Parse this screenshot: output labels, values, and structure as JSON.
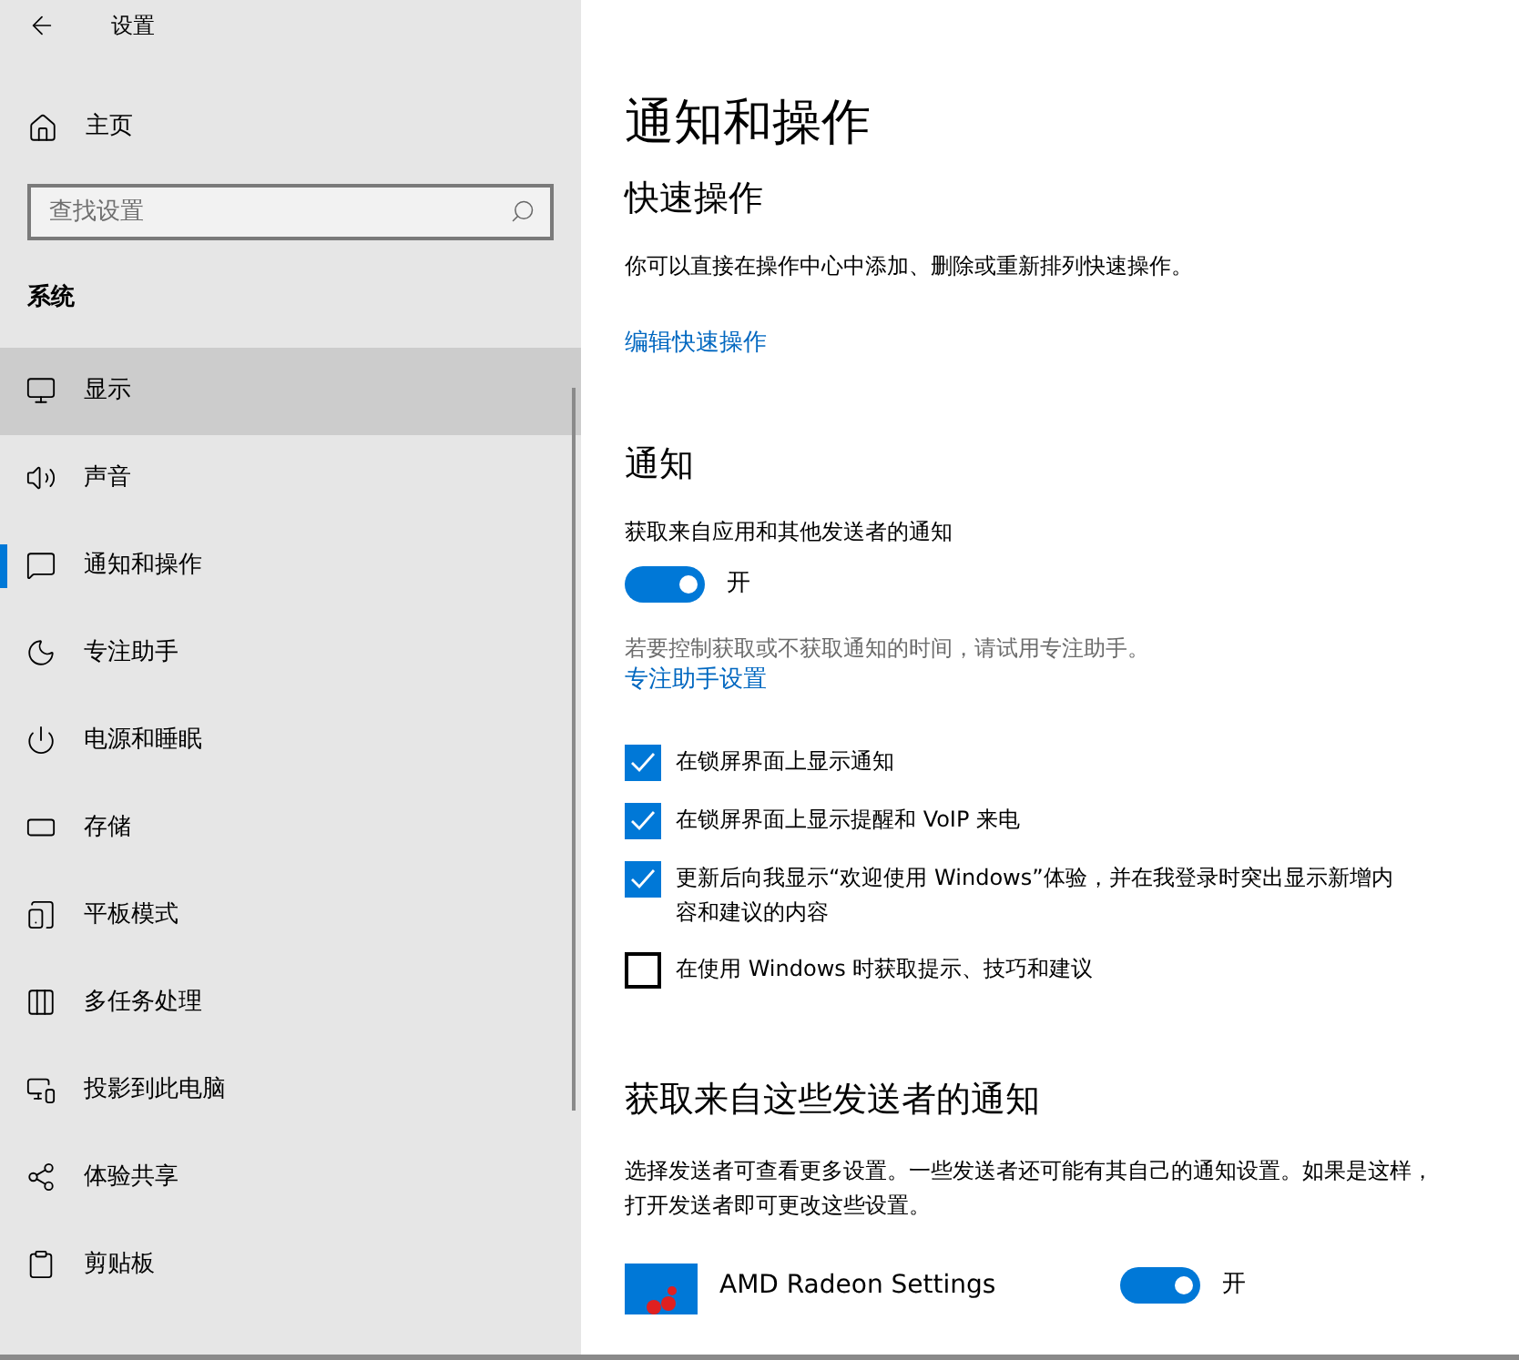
{
  "window": {
    "title": "设置"
  },
  "sidebar": {
    "home": "主页",
    "search": {
      "placeholder": "查找设置"
    },
    "section": "系统",
    "items": [
      {
        "label": "显示",
        "selected": false,
        "hovered": true
      },
      {
        "label": "声音",
        "selected": false,
        "hovered": false
      },
      {
        "label": "通知和操作",
        "selected": true,
        "hovered": false
      },
      {
        "label": "专注助手",
        "selected": false,
        "hovered": false
      },
      {
        "label": "电源和睡眠",
        "selected": false,
        "hovered": false
      },
      {
        "label": "存储",
        "selected": false,
        "hovered": false
      },
      {
        "label": "平板模式",
        "selected": false,
        "hovered": false
      },
      {
        "label": "多任务处理",
        "selected": false,
        "hovered": false
      },
      {
        "label": "投影到此电脑",
        "selected": false,
        "hovered": false
      },
      {
        "label": "体验共享",
        "selected": false,
        "hovered": false
      },
      {
        "label": "剪贴板",
        "selected": false,
        "hovered": false
      }
    ]
  },
  "main": {
    "title": "通知和操作",
    "quick_actions": {
      "heading": "快速操作",
      "description": "你可以直接在操作中心中添加、删除或重新排列快速操作。",
      "link": "编辑快速操作"
    },
    "notifications": {
      "heading": "通知",
      "toggle": {
        "label": "获取来自应用和其他发送者的通知",
        "on": true,
        "state_text": "开"
      },
      "hint": "若要控制获取或不获取通知的时间，请试用专注助手。",
      "link": "专注助手设置",
      "options": [
        {
          "label": "在锁屏界面上显示通知",
          "checked": true
        },
        {
          "label": "在锁屏界面上显示提醒和 VoIP 来电",
          "checked": true
        },
        {
          "label": "更新后向我显示“欢迎使用 Windows”体验，并在我登录时突出显示新增内容和建议的内容",
          "checked": true
        },
        {
          "label": "在使用 Windows 时获取提示、技巧和建议",
          "checked": false
        }
      ]
    },
    "senders": {
      "heading": "获取来自这些发送者的通知",
      "description": "选择发送者可查看更多设置。一些发送者还可能有其自己的通知设置。如果是这样，打开发送者即可更改这些设置。",
      "apps": [
        {
          "name": "AMD Radeon Settings",
          "on": true,
          "state_text": "开"
        }
      ]
    }
  }
}
